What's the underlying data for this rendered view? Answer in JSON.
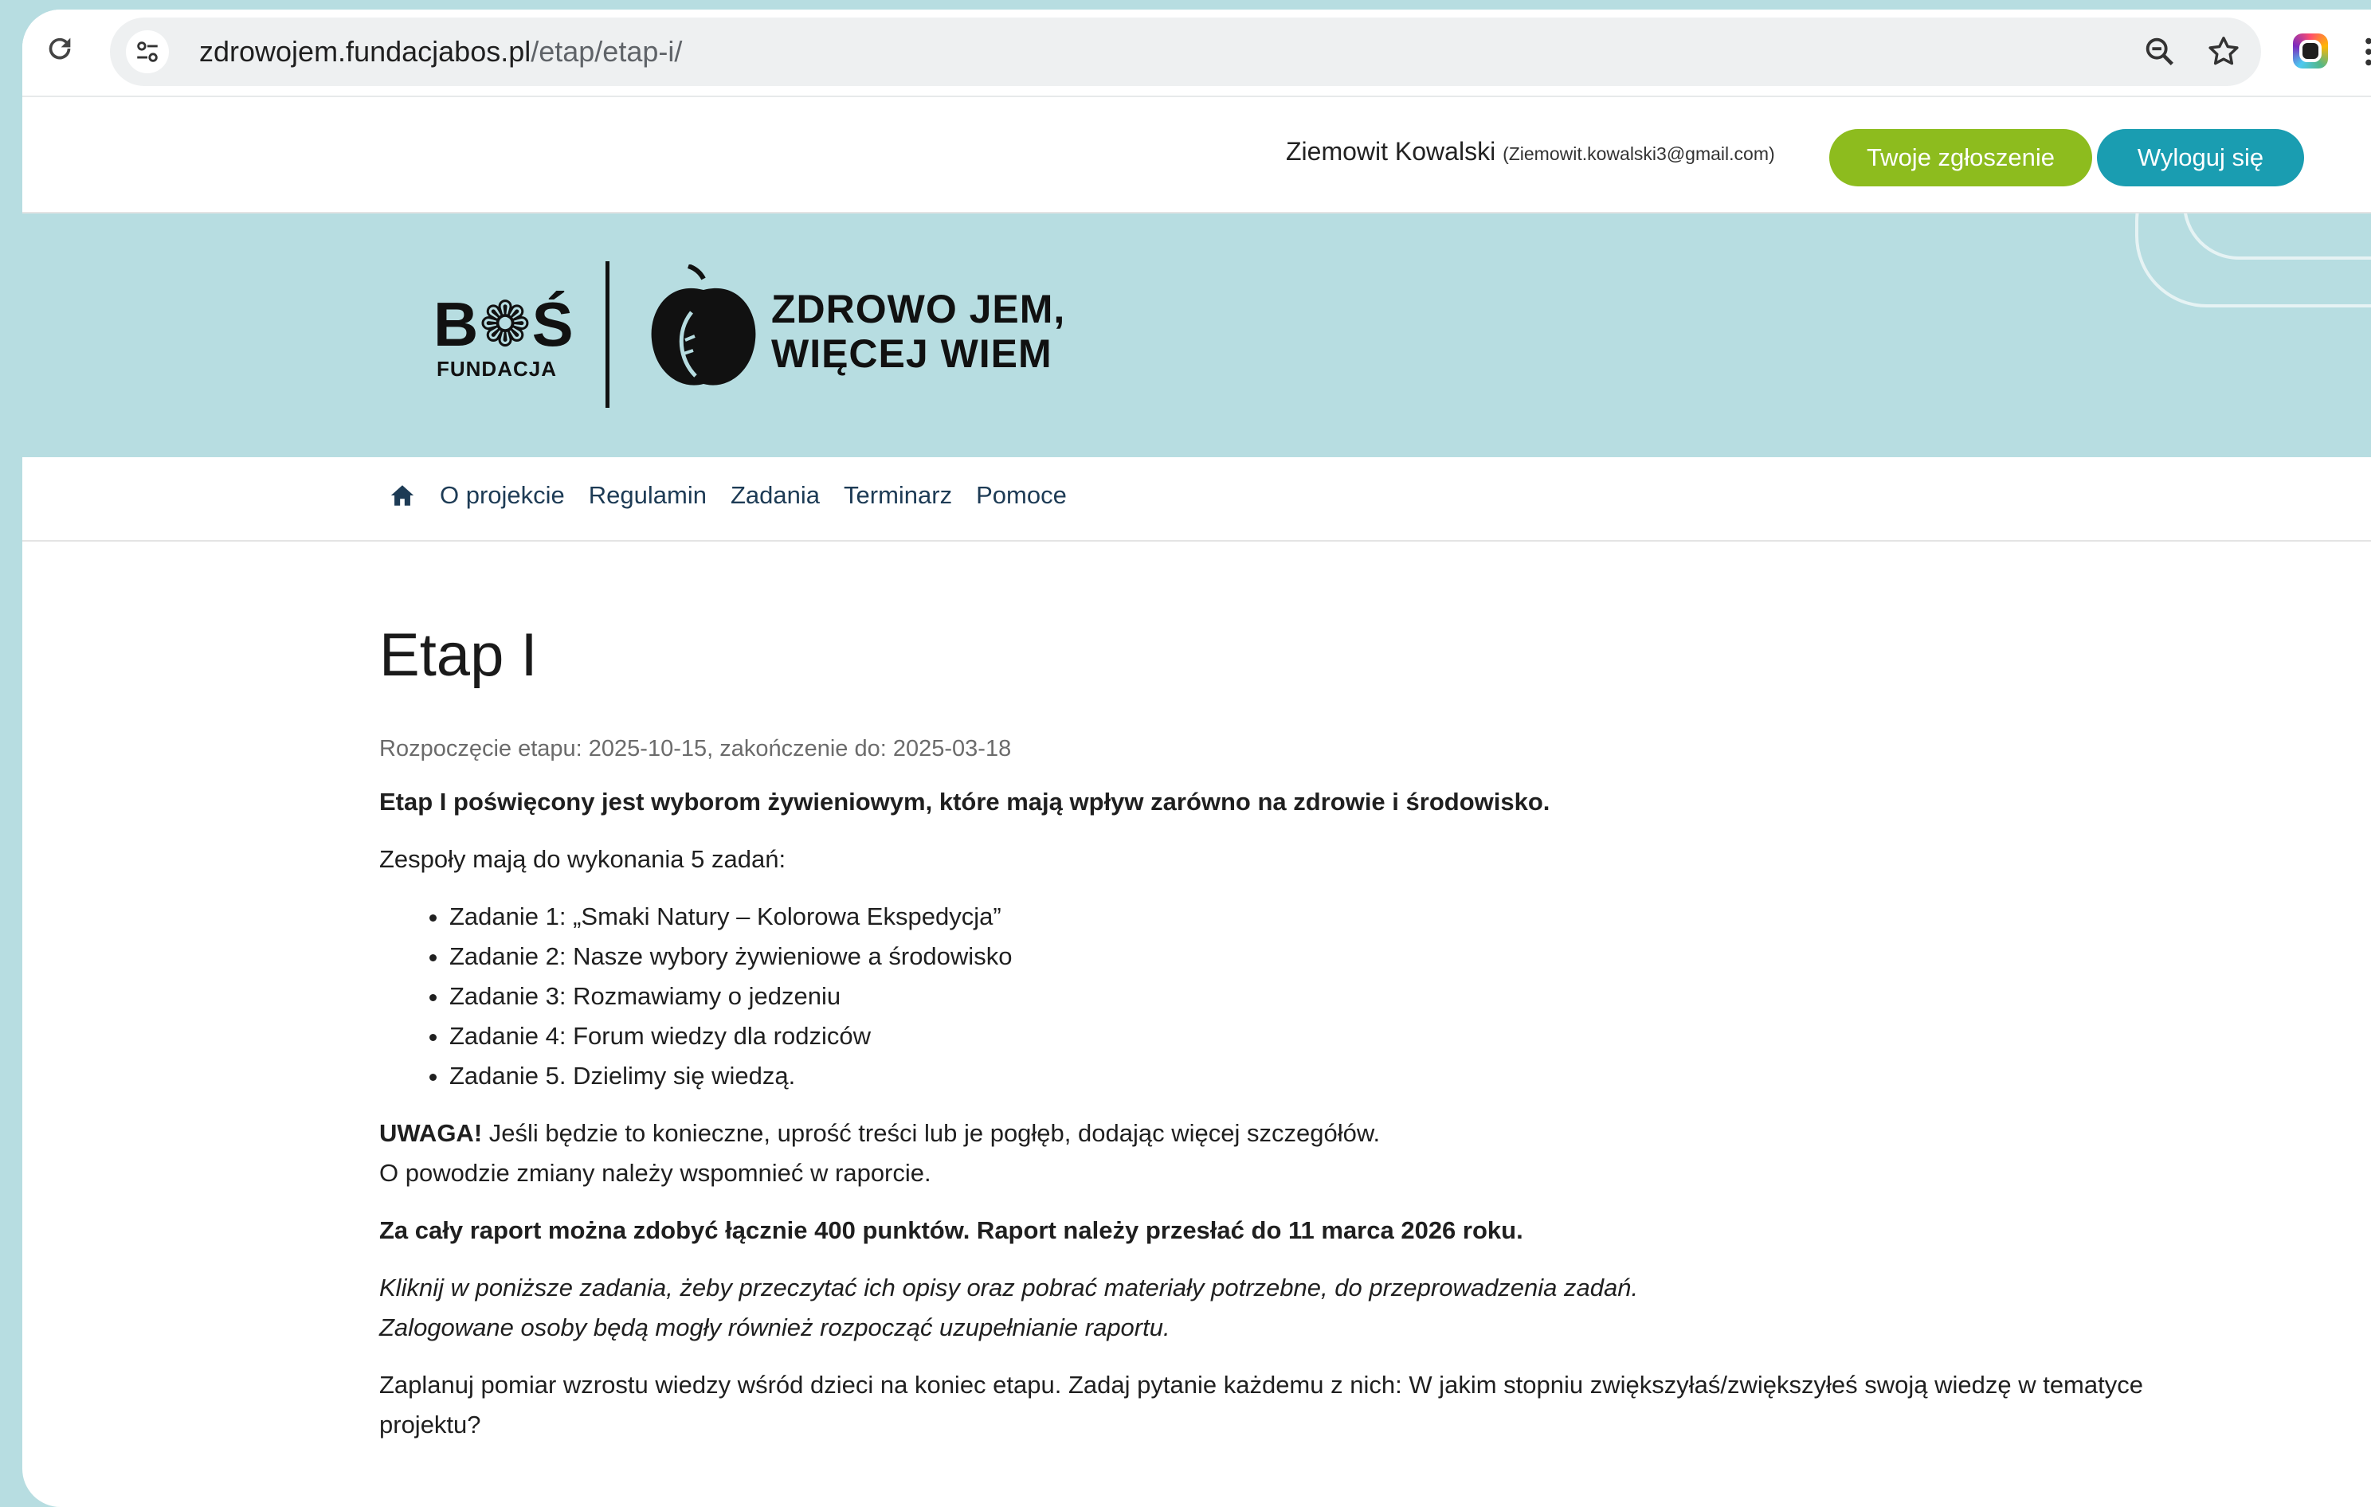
{
  "browser": {
    "url_host": "zdrowojem.fundacjabos.pl",
    "url_path": "/etap/etap-i/"
  },
  "user": {
    "name": "Ziemowit Kowalski",
    "email": "(Ziemowit.kowalski3@gmail.com)",
    "application_button": "Twoje zgłoszenie",
    "logout_button": "Wyloguj się"
  },
  "header": {
    "logo_bos": "B❁Ś",
    "logo_fundacja": "FUNDACJA",
    "project_line1": "ZDROWO JEM,",
    "project_line2": "WIĘCEJ WIEM"
  },
  "nav": {
    "items": [
      {
        "label": "O projekcie"
      },
      {
        "label": "Regulamin"
      },
      {
        "label": "Zadania"
      },
      {
        "label": "Terminarz"
      },
      {
        "label": "Pomoce"
      }
    ]
  },
  "main": {
    "title": "Etap I",
    "dates": "Rozpoczęcie etapu: 2025-10-15, zakończenie do: 2025-03-18",
    "intro": "Etap I poświęcony jest wyborom żywieniowym, które mają wpływ zarówno na zdrowie i środowisko.",
    "tasks_intro": "Zespoły mają do wykonania 5 zadań:",
    "tasks": [
      "Zadanie 1: „Smaki Natury – Kolorowa Ekspedycja”",
      "Zadanie 2: Nasze wybory żywieniowe a środowisko",
      "Zadanie 3: Rozmawiamy o jedzeniu",
      "Zadanie 4: Forum wiedzy dla rodziców",
      "Zadanie 5. Dzielimy się wiedzą."
    ],
    "warning_label": "UWAGA!",
    "warning_text": " Jeśli będzie to konieczne, uprość treści lub je pogłęb, dodając więcej szczegółów.",
    "warning_line2": "O powodzie zmiany należy wspomnieć w raporcie.",
    "points": "Za cały raport można zdobyć łącznie 400 punktów. Raport należy przesłać do 11 marca 2026 roku.",
    "click_line1": "Kliknij w poniższe zadania, żeby przeczytać ich opisy oraz pobrać materiały potrzebne, do przeprowadzenia zadań.",
    "click_line2": "Zalogowane osoby będą mogły również rozpocząć uzupełnianie raportu.",
    "plan": "Zaplanuj pomiar wzrostu wiedzy wśród dzieci na koniec etapu. Zadaj pytanie każdemu z nich: W jakim stopniu zwiększyłaś/zwiększyłeś swoją wiedzę w tematyce projektu?"
  },
  "colors": {
    "banner": "#b7dde1",
    "green_button": "#8dbc1e",
    "blue_button": "#1a9db1",
    "nav_link": "#1d3b55"
  },
  "icons": [
    "reload-icon",
    "site-settings-icon",
    "zoom-icon",
    "star-icon",
    "extension-icon",
    "more-icon",
    "home-icon",
    "apple-icon"
  ]
}
